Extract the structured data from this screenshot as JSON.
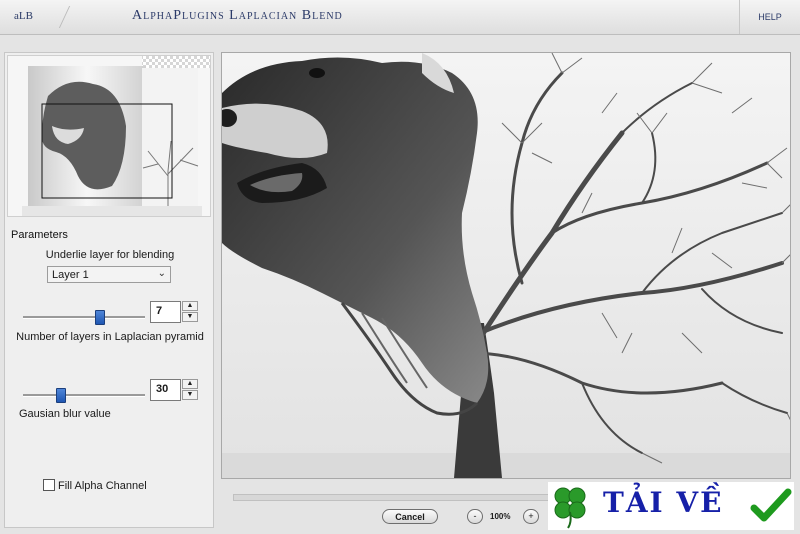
{
  "header": {
    "logo": "aLB",
    "title": "AlphaPlugins Laplacian Blend",
    "help": "HELP"
  },
  "parameters": {
    "title": "Parameters",
    "underlie_label": "Underlie layer for blending",
    "layer_select": {
      "value": "Layer 1"
    },
    "pyramid": {
      "value": "7",
      "slider_fraction": 0.62,
      "label": "Number of layers in Laplacian pyramid"
    },
    "blur": {
      "value": "30",
      "slider_fraction": 0.3,
      "label": "Gausian blur value"
    },
    "fill_alpha": {
      "label": "Fill Alpha Channel",
      "checked": false
    }
  },
  "footer": {
    "cancel": "Cancel",
    "zoom_out": "-",
    "zoom_level": "100%",
    "zoom_in": "+"
  },
  "watermark": {
    "text": "TẢI VỀ",
    "icons": [
      "clover-icon",
      "checkmark-icon"
    ]
  },
  "colors": {
    "title_text": "#2b3a68",
    "slider_thumb": "#2a62c0",
    "watermark_text": "#1620a8",
    "clover": "#2a9a2a",
    "check": "#1e9a1e"
  }
}
